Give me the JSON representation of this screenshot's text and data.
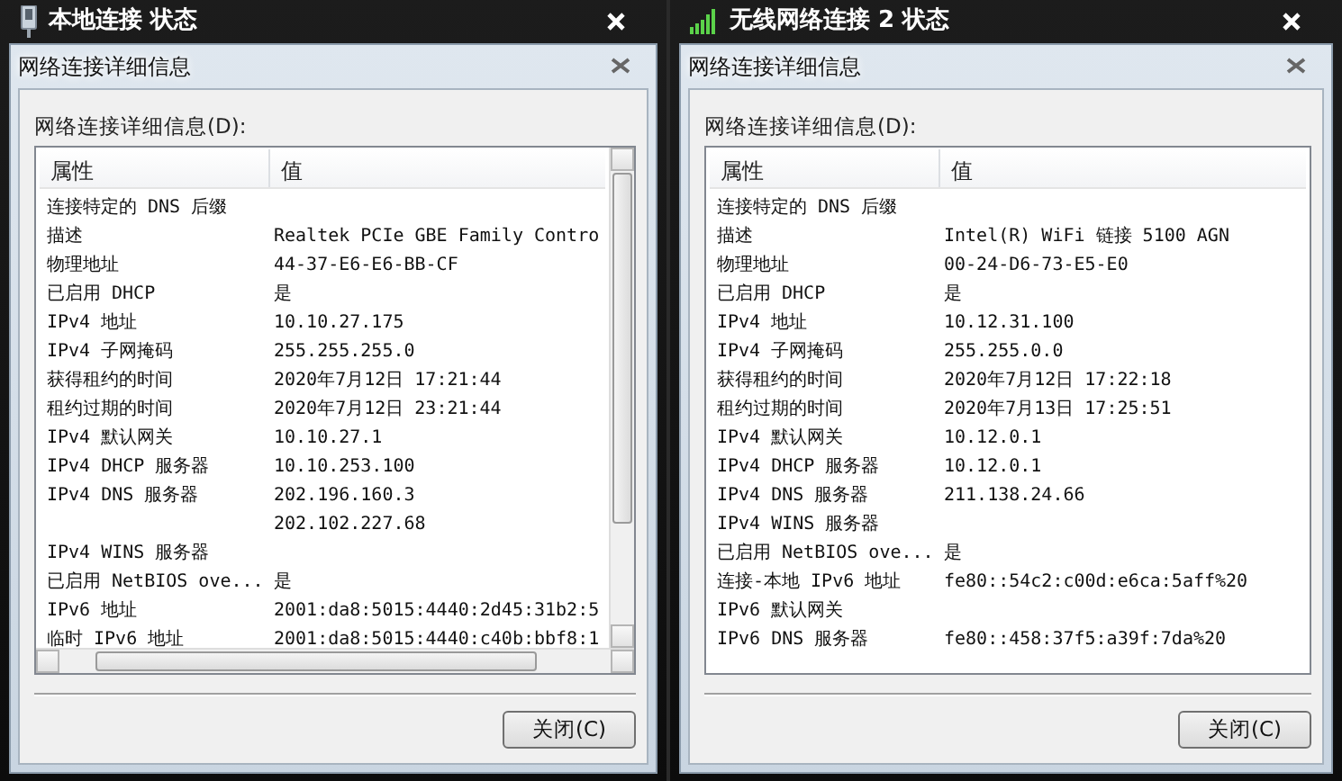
{
  "windows": [
    {
      "title": "本地连接 状态",
      "kind": "wired",
      "dialog": {
        "title": "网络连接详细信息",
        "list_label": "网络连接详细信息(D):",
        "columns": [
          "属性",
          "值"
        ],
        "scrollbars": true,
        "rows": [
          {
            "property": "连接特定的 DNS 后缀"
          },
          {
            "property": "描述",
            "value": "Realtek PCIe GBE Family Contro"
          },
          {
            "property": "物理地址",
            "value": "44-37-E6-E6-BB-CF"
          },
          {
            "property": "已启用 DHCP",
            "value": "是"
          },
          {
            "property": "IPv4 地址",
            "value": "10.10.27.175"
          },
          {
            "property": "IPv4 子网掩码",
            "value": "255.255.255.0"
          },
          {
            "property": "获得租约的时间",
            "value": "2020年7月12日 17:21:44"
          },
          {
            "property": "租约过期的时间",
            "value": "2020年7月12日 23:21:44"
          },
          {
            "property": "IPv4 默认网关",
            "value": "10.10.27.1"
          },
          {
            "property": "IPv4 DHCP 服务器",
            "value": "10.10.253.100"
          },
          {
            "property": "IPv4 DNS 服务器",
            "value": "202.196.160.3"
          },
          {
            "value": "202.102.227.68"
          },
          {
            "property": "IPv4 WINS 服务器"
          },
          {
            "property": "已启用 NetBIOS ove...",
            "value": "是"
          },
          {
            "property": "IPv6 地址",
            "value": "2001:da8:5015:4440:2d45:31b2:5"
          },
          {
            "property": "临时 IPv6 地址",
            "value": "2001:da8:5015:4440:c40b:bbf8:1"
          }
        ],
        "button": "关闭(C)"
      }
    },
    {
      "title": "无线网络连接 2 状态",
      "kind": "wireless",
      "dialog": {
        "title": "网络连接详细信息",
        "list_label": "网络连接详细信息(D):",
        "columns": [
          "属性",
          "值"
        ],
        "scrollbars": false,
        "rows": [
          {
            "property": "连接特定的 DNS 后缀"
          },
          {
            "property": "描述",
            "value": "Intel(R) WiFi 链接 5100 AGN"
          },
          {
            "property": "物理地址",
            "value": "00-24-D6-73-E5-E0"
          },
          {
            "property": "已启用 DHCP",
            "value": "是"
          },
          {
            "property": "IPv4 地址",
            "value": "10.12.31.100"
          },
          {
            "property": "IPv4 子网掩码",
            "value": "255.255.0.0"
          },
          {
            "property": "获得租约的时间",
            "value": "2020年7月12日 17:22:18"
          },
          {
            "property": "租约过期的时间",
            "value": "2020年7月13日 17:25:51"
          },
          {
            "property": "IPv4 默认网关",
            "value": "10.12.0.1"
          },
          {
            "property": "IPv4 DHCP 服务器",
            "value": "10.12.0.1"
          },
          {
            "property": "IPv4 DNS 服务器",
            "value": "211.138.24.66"
          },
          {
            "property": "IPv4 WINS 服务器"
          },
          {
            "property": "已启用 NetBIOS ove...",
            "value": "是"
          },
          {
            "property": "连接-本地 IPv6 地址",
            "value": "fe80::54c2:c00d:e6ca:5aff%20"
          },
          {
            "property": "IPv6 默认网关"
          },
          {
            "property": "IPv6 DNS 服务器",
            "value": "fe80::458:37f5:a39f:7da%20"
          }
        ],
        "button": "关闭(C)"
      }
    }
  ]
}
